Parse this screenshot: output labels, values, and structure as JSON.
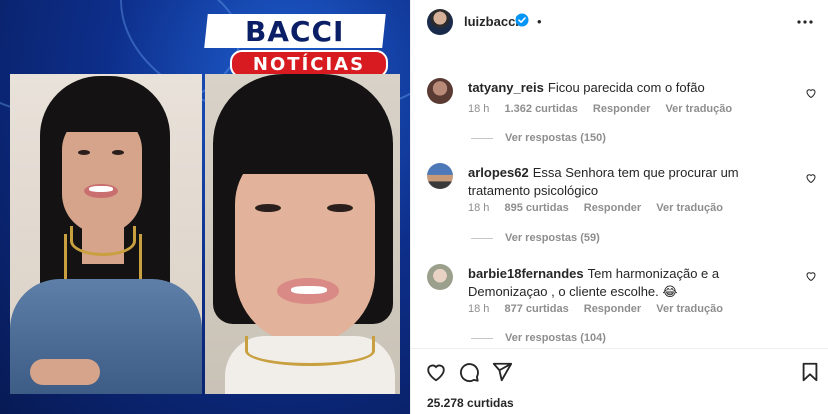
{
  "media": {
    "brand_line1": "BACCI",
    "brand_line2": "NOTÍCIAS",
    "colors": {
      "background": "#0d2e8a",
      "brand_red": "#d81b20",
      "brand_navy": "#0b1f66"
    }
  },
  "post": {
    "username": "luizbacci",
    "verified": true,
    "separator": "•",
    "more_icon": "more-horizontal-icon"
  },
  "comments": [
    {
      "username": "tatyany_reis",
      "text": "Ficou parecida com o fofão",
      "time": "18 h",
      "likes": "1.362 curtidas",
      "reply_label": "Responder",
      "translate_label": "Ver tradução",
      "view_replies": "Ver respostas (150)"
    },
    {
      "username": "arlopes62",
      "text": "Essa Senhora tem que procurar um tratamento psicológico",
      "time": "18 h",
      "likes": "895 curtidas",
      "reply_label": "Responder",
      "translate_label": "Ver tradução",
      "view_replies": "Ver respostas (59)"
    },
    {
      "username": "barbie18fernandes",
      "text": "Tem harmonização e a Demonizaçao , o cliente escolhe. 😂",
      "time": "18 h",
      "likes": "877 curtidas",
      "reply_label": "Responder",
      "translate_label": "Ver tradução",
      "view_replies": "Ver respostas (104)"
    }
  ],
  "actions": {
    "icons": [
      "heart-icon",
      "comment-icon",
      "share-icon",
      "bookmark-icon"
    ],
    "likes_count": "25.278 curtidas"
  },
  "colors": {
    "text": "#262626",
    "muted": "#8e8e8e",
    "verified_blue": "#0095f6"
  }
}
